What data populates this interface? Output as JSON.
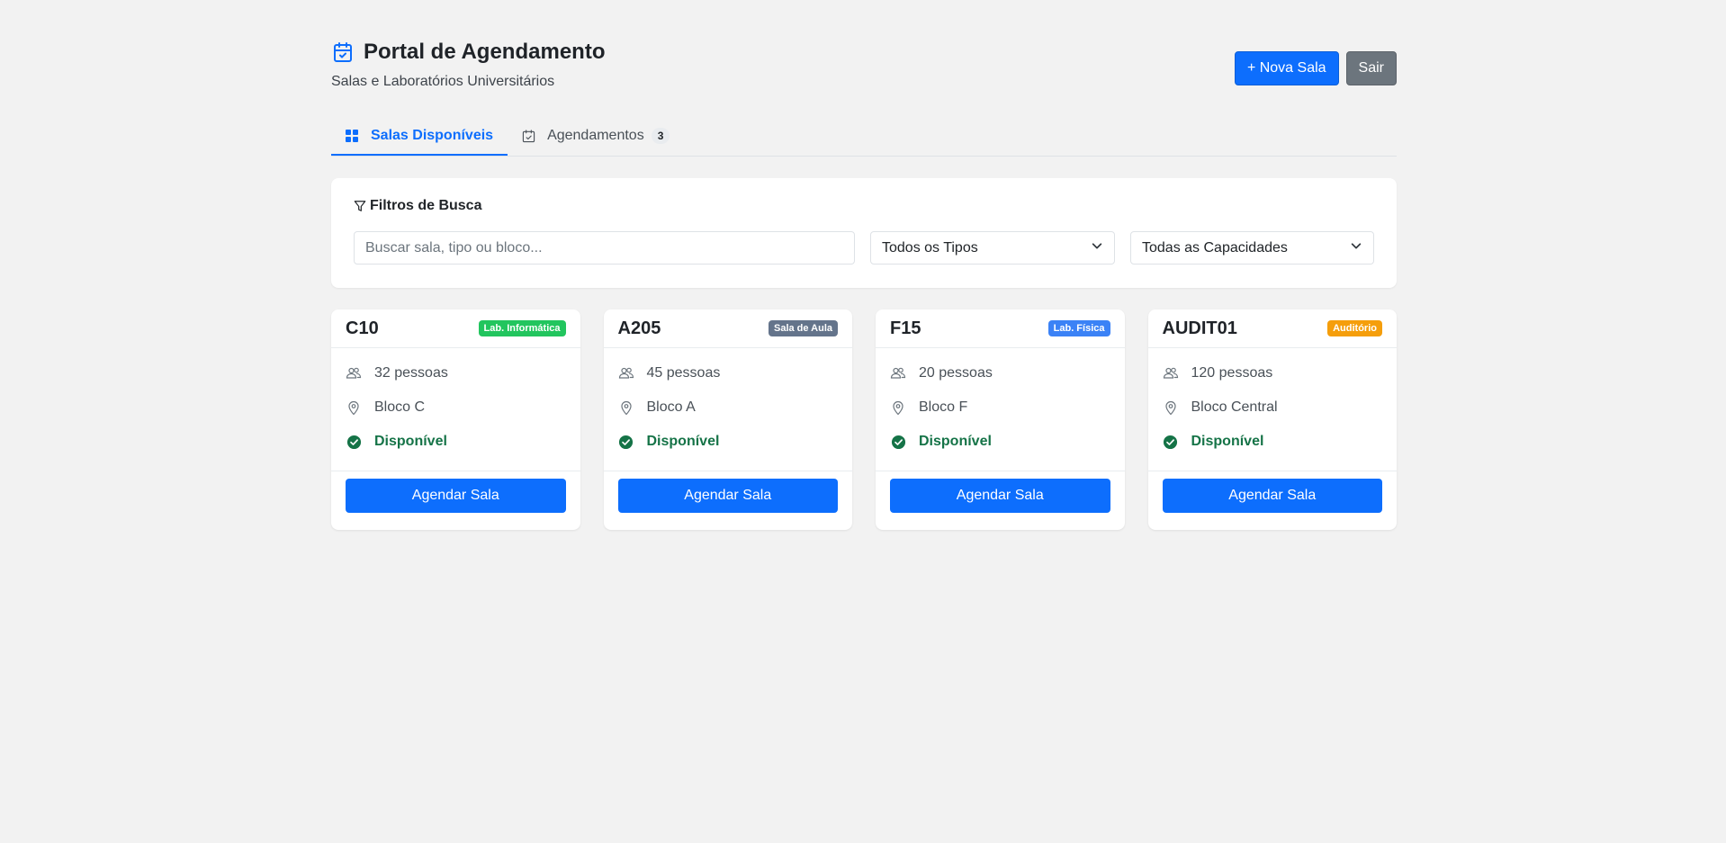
{
  "header": {
    "title": "Portal de Agendamento",
    "subtitle": "Salas e Laboratórios Universitários",
    "new_room_label": "+ Nova Sala",
    "logout_label": "Sair"
  },
  "tabs": [
    {
      "label": "Salas Disponíveis",
      "icon": "grid-icon",
      "active": true
    },
    {
      "label": "Agendamentos",
      "icon": "calendar-check-icon",
      "badge": "3",
      "active": false
    }
  ],
  "filters": {
    "title": "Filtros de Busca",
    "search_placeholder": "Buscar sala, tipo ou bloco...",
    "search_value": "",
    "type_select": "Todos os Tipos",
    "capacity_select": "Todas as Capacidades"
  },
  "rooms": [
    {
      "name": "C10",
      "type": "Lab. Informática",
      "type_color": "#22c55e",
      "capacity": "32 pessoas",
      "location": "Bloco C",
      "status": "Disponível",
      "action": "Agendar Sala"
    },
    {
      "name": "A205",
      "type": "Sala de Aula",
      "type_color": "#64748b",
      "capacity": "45 pessoas",
      "location": "Bloco A",
      "status": "Disponível",
      "action": "Agendar Sala"
    },
    {
      "name": "F15",
      "type": "Lab. Física",
      "type_color": "#3b82f6",
      "capacity": "20 pessoas",
      "location": "Bloco F",
      "status": "Disponível",
      "action": "Agendar Sala"
    },
    {
      "name": "AUDIT01",
      "type": "Auditório",
      "type_color": "#f59e0b",
      "capacity": "120 pessoas",
      "location": "Bloco Central",
      "status": "Disponível",
      "action": "Agendar Sala"
    }
  ],
  "colors": {
    "primary": "#0d6efd",
    "secondary": "#6c757d",
    "success": "#157347",
    "background": "#f2f2f2"
  }
}
